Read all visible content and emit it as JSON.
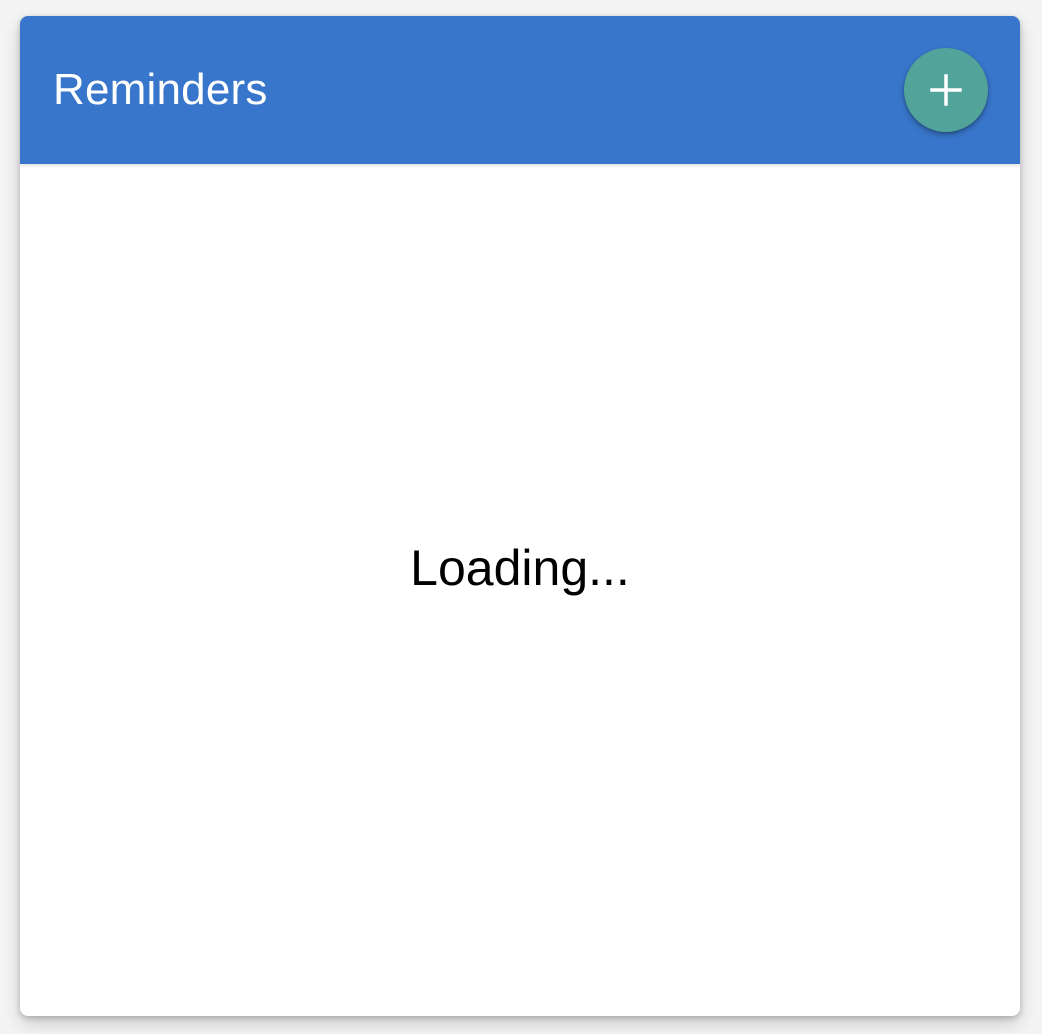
{
  "app": {
    "title": "Reminders"
  },
  "header": {
    "add_button": {
      "icon": "plus-icon",
      "color": "#52a39a"
    },
    "background_color": "#3876cb"
  },
  "content": {
    "status_text": "Loading..."
  }
}
